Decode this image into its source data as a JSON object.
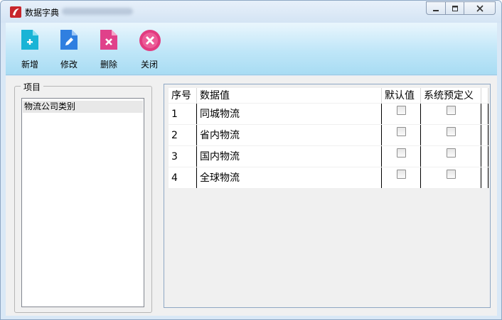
{
  "window": {
    "title": "数据字典",
    "controls": {
      "minimize": "minimize-icon",
      "maximize": "restore-icon",
      "close": "close-icon"
    }
  },
  "toolbar": {
    "buttons": [
      {
        "label": "新增",
        "icon": "add-icon",
        "color": "#19b4d6"
      },
      {
        "label": "修改",
        "icon": "edit-icon",
        "color": "#2f7fe0"
      },
      {
        "label": "删除",
        "icon": "delete-icon",
        "color": "#e0418a"
      },
      {
        "label": "关闭",
        "icon": "close-circle-icon",
        "color": "#e23b80"
      }
    ]
  },
  "projects": {
    "legend": "项目",
    "items": [
      "物流公司类别"
    ]
  },
  "grid": {
    "columns": [
      "序号",
      "数据值",
      "默认值",
      "系统预定义"
    ],
    "rows": [
      {
        "index": "1",
        "value": "同城物流",
        "is_default": false,
        "is_system": false
      },
      {
        "index": "2",
        "value": "省内物流",
        "is_default": false,
        "is_system": false
      },
      {
        "index": "3",
        "value": "国内物流",
        "is_default": false,
        "is_system": false
      },
      {
        "index": "4",
        "value": "全球物流",
        "is_default": false,
        "is_system": false
      }
    ]
  }
}
